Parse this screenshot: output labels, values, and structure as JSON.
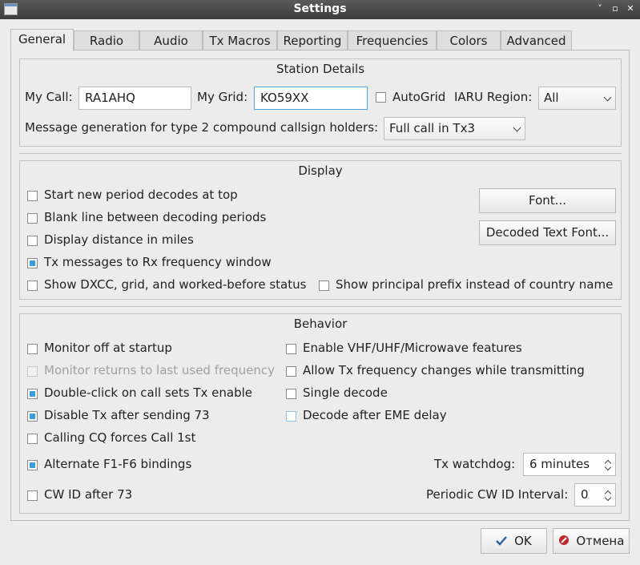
{
  "window": {
    "title": "Settings",
    "controls": [
      "˅",
      "▫",
      "✕"
    ]
  },
  "tabs": [
    {
      "label": "General",
      "active": true
    },
    {
      "label": "Radio"
    },
    {
      "label": "Audio"
    },
    {
      "label": "Tx Macros"
    },
    {
      "label": "Reporting"
    },
    {
      "label": "Frequencies"
    },
    {
      "label": "Colors"
    },
    {
      "label": "Advanced"
    }
  ],
  "station": {
    "title": "Station Details",
    "my_call_label": "My Call:",
    "my_call_value": "RA1AHQ",
    "my_grid_label": "My Grid:",
    "my_grid_value": "KO59XX",
    "autogrid_label": "AutoGrid",
    "autogrid_checked": false,
    "iaru_label": "IARU Region:",
    "iaru_value": "All",
    "msg_gen_label": "Message generation for type 2 compound callsign holders:",
    "msg_gen_value": "Full call in Tx3"
  },
  "display": {
    "title": "Display",
    "items": [
      {
        "label": "Start new period decodes at top",
        "checked": false
      },
      {
        "label": "Blank line between decoding periods",
        "checked": false
      },
      {
        "label": "Display distance in miles",
        "checked": false
      },
      {
        "label": "Tx messages to Rx frequency window",
        "checked": true
      },
      {
        "label": "Show DXCC, grid, and worked-before status",
        "checked": false
      },
      {
        "label": "Show principal prefix instead of country name",
        "checked": false
      }
    ],
    "font_button": "Font...",
    "decoded_font_button": "Decoded Text Font..."
  },
  "behavior": {
    "title": "Behavior",
    "left": [
      {
        "label": "Monitor off at startup",
        "checked": false
      },
      {
        "label": "Monitor returns to last used frequency",
        "checked": false,
        "disabled": true
      },
      {
        "label": "Double-click on call sets Tx enable",
        "checked": true
      },
      {
        "label": "Disable Tx after sending 73",
        "checked": true
      },
      {
        "label": "Calling CQ forces Call 1st",
        "checked": false
      },
      {
        "label": "Alternate F1-F6 bindings",
        "checked": true
      },
      {
        "label": "CW ID after 73",
        "checked": false
      }
    ],
    "right": [
      {
        "label": "Enable VHF/UHF/Microwave features",
        "checked": false
      },
      {
        "label": "Allow Tx frequency changes while transmitting",
        "checked": false
      },
      {
        "label": "Single decode",
        "checked": false
      },
      {
        "label": "Decode after EME delay",
        "checked": false
      }
    ],
    "tx_watchdog_label": "Tx watchdog:",
    "tx_watchdog_value": "6 minutes",
    "cw_interval_label": "Periodic CW ID Interval:",
    "cw_interval_value": "0"
  },
  "footer": {
    "ok": "OK",
    "cancel": "Отмена"
  }
}
